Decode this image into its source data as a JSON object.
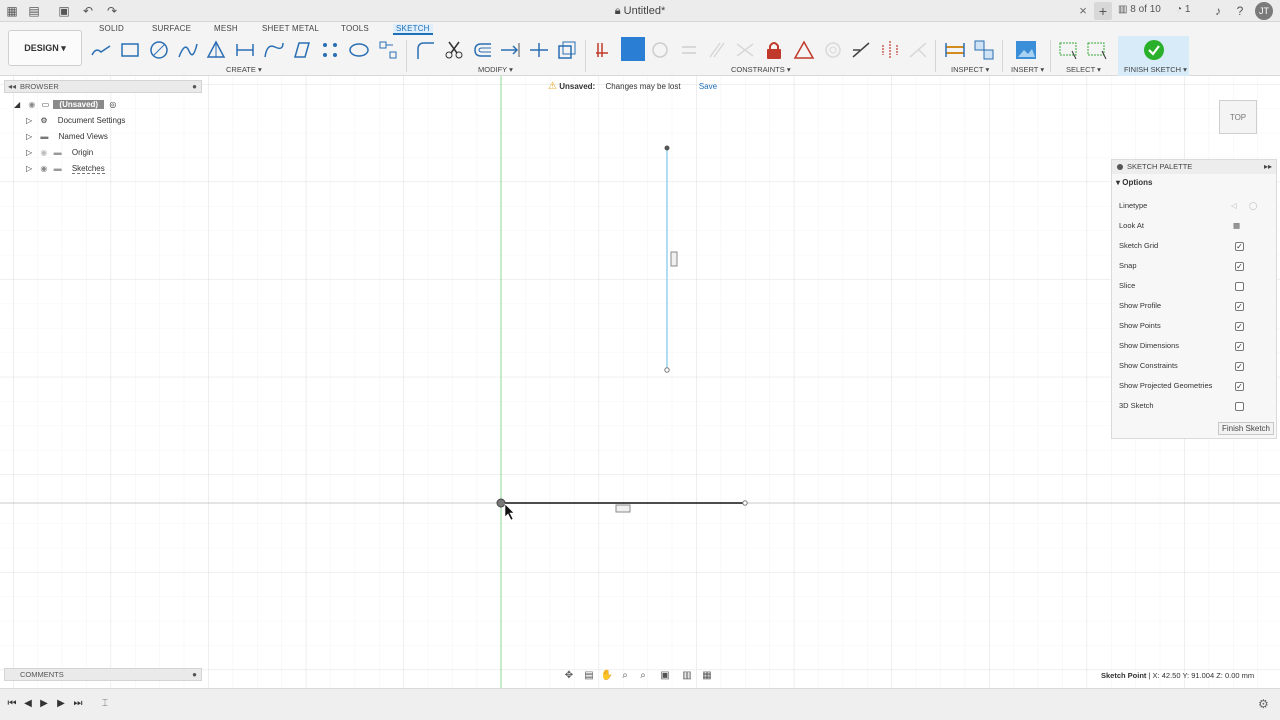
{
  "titlebar": {
    "title": "Untitled*",
    "job_status": "8 of 10",
    "notifications": "1",
    "user_initials": "JT"
  },
  "workspace": {
    "label": "DESIGN ▾"
  },
  "tabs": [
    {
      "label": "SOLID"
    },
    {
      "label": "SURFACE"
    },
    {
      "label": "MESH"
    },
    {
      "label": "SHEET METAL"
    },
    {
      "label": "TOOLS"
    },
    {
      "label": "SKETCH"
    }
  ],
  "groups": {
    "create": "CREATE ▾",
    "modify": "MODIFY ▾",
    "constraints": "CONSTRAINTS ▾",
    "inspect": "INSPECT ▾",
    "insert": "INSERT ▾",
    "select": "SELECT ▾",
    "finish": "FINISH SKETCH ▾"
  },
  "browser": {
    "title": "BROWSER",
    "items": [
      {
        "label": "(Unsaved)"
      },
      {
        "label": "Document Settings"
      },
      {
        "label": "Named Views"
      },
      {
        "label": "Origin"
      },
      {
        "label": "Sketches"
      }
    ]
  },
  "banner": {
    "status": "Unsaved:",
    "message": "Changes may be lost",
    "save": "Save"
  },
  "viewcube": {
    "label": "TOP"
  },
  "palette": {
    "title": "SKETCH PALETTE",
    "section": "Options",
    "options": [
      {
        "label": "Linetype",
        "kind": "linetype"
      },
      {
        "label": "Look At",
        "kind": "icon"
      },
      {
        "label": "Sketch Grid",
        "checked": true
      },
      {
        "label": "Snap",
        "checked": true
      },
      {
        "label": "Slice",
        "checked": false
      },
      {
        "label": "Show Profile",
        "checked": true
      },
      {
        "label": "Show Points",
        "checked": true
      },
      {
        "label": "Show Dimensions",
        "checked": true
      },
      {
        "label": "Show Constraints",
        "checked": true
      },
      {
        "label": "Show Projected Geometries",
        "checked": true
      },
      {
        "label": "3D Sketch",
        "checked": false
      }
    ],
    "finish_button": "Finish Sketch"
  },
  "comments": {
    "title": "COMMENTS"
  },
  "status": {
    "label": "Sketch Point",
    "coords": " | X: 42.50 Y: 91.004 Z: 0.00 mm"
  },
  "colors": {
    "accent": "#1d6fb8",
    "finish_green": "#2ab02a",
    "vertical_line": "#8fd0ea",
    "axis_green": "#8fd68f",
    "grid": "#e3e3e3"
  }
}
